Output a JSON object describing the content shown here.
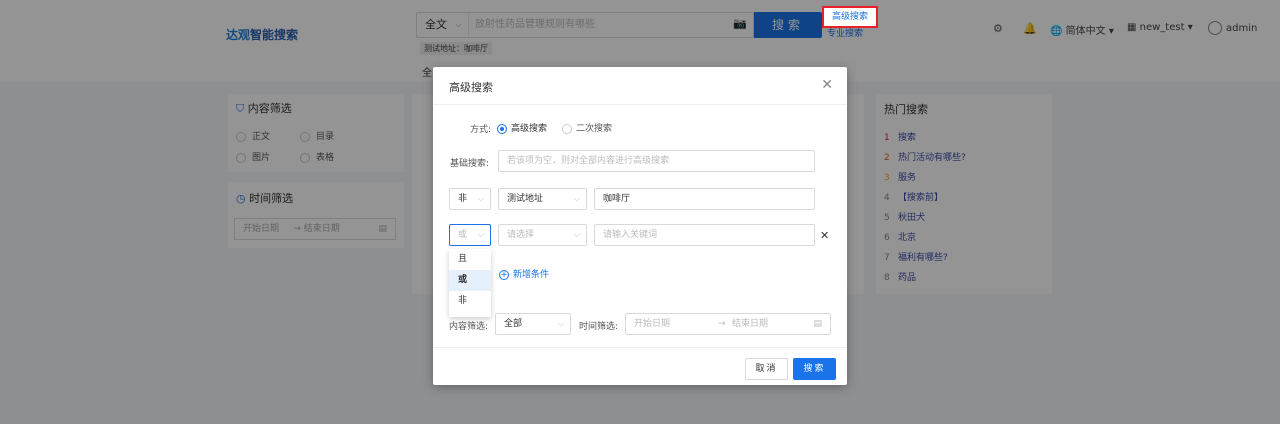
{
  "header": {
    "logo_mark": "达观",
    "logo_text": "智能搜索",
    "scope": "全文",
    "search_placeholder": "放射性药品管理规则有哪些",
    "search_button": "搜索",
    "advanced_link": "高级搜索",
    "pro_link": "专业搜索",
    "tag": "测试地址：咖啡厅",
    "tabs_partial": "全",
    "language": "简体中文",
    "workspace": "new_test",
    "user": "admin"
  },
  "sidebar": {
    "content_filter_title": "内容筛选",
    "content_options": [
      "正文",
      "目录",
      "图片",
      "表格"
    ],
    "time_filter_title": "时间筛选",
    "start_date": "开始日期",
    "end_date": "结束日期"
  },
  "hot": {
    "title": "热门搜索",
    "items": [
      {
        "num": "1",
        "text": "搜索"
      },
      {
        "num": "2",
        "text": "热门活动有哪些?"
      },
      {
        "num": "3",
        "text": "服务"
      },
      {
        "num": "4",
        "text": "【搜索前】"
      },
      {
        "num": "5",
        "text": "秋田犬"
      },
      {
        "num": "6",
        "text": "北京"
      },
      {
        "num": "7",
        "text": "福利有哪些?"
      },
      {
        "num": "8",
        "text": "药品"
      }
    ]
  },
  "modal": {
    "title": "高级搜索",
    "method_label": "方式:",
    "method_options": [
      "高级搜索",
      "二次搜索"
    ],
    "basic_label": "基础搜索:",
    "basic_placeholder": "若该项为空，则对全部内容进行高级搜索",
    "row1": {
      "op": "非",
      "field": "测试地址",
      "value": "咖啡厅"
    },
    "row2": {
      "op": "或",
      "field_placeholder": "请选择",
      "value_placeholder": "请输入关键词"
    },
    "op_options": [
      "且",
      "或",
      "非"
    ],
    "add_condition": "新增条件",
    "content_filter_label": "内容筛选:",
    "content_filter_value": "全部",
    "time_filter_label": "时间筛选:",
    "start_placeholder": "开始日期",
    "end_placeholder": "结束日期",
    "cancel": "取消",
    "search": "搜索"
  }
}
